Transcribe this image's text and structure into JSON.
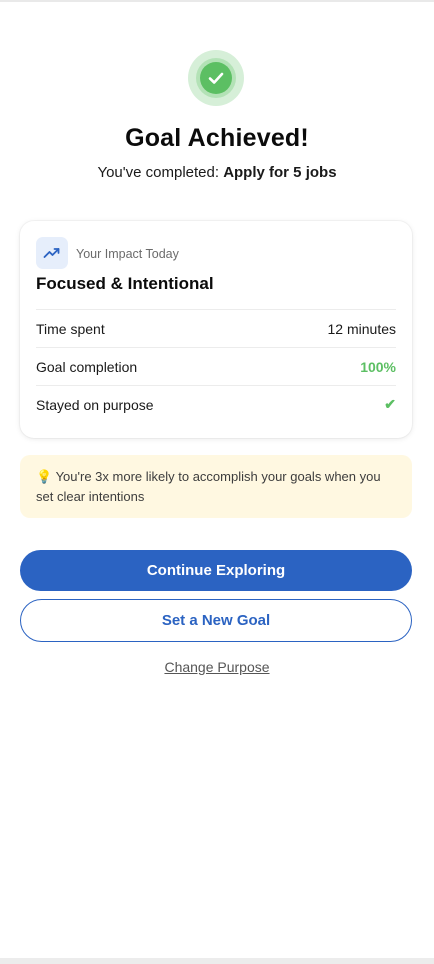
{
  "header": {
    "title": "Goal Achieved!",
    "subtitle_prefix": "You've completed: ",
    "goal_name": "Apply for 5 jobs",
    "badge_icon": "checkmark-icon"
  },
  "impact": {
    "eyebrow": "Your Impact Today",
    "heading": "Focused & Intentional",
    "icon": "trending-up-icon",
    "stats": [
      {
        "label": "Time spent",
        "value": "12 minutes"
      },
      {
        "label": "Goal completion",
        "value": "100%"
      },
      {
        "label": "Stayed on purpose",
        "value": "✔"
      }
    ]
  },
  "tip": {
    "icon": "💡",
    "text": "You're 3x more likely to accomplish your goals when you set clear intentions"
  },
  "actions": {
    "primary_label": "Continue Exploring",
    "secondary_label": "Set a New Goal",
    "link_label": "Change Purpose"
  },
  "colors": {
    "accent": "#2b63c2",
    "success": "#5cbf63",
    "tip_background": "#fff8e1"
  }
}
